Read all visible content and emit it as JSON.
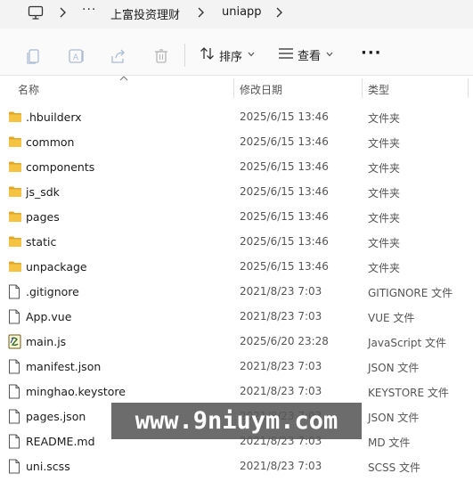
{
  "breadcrumb": {
    "more": "···",
    "items": [
      "上富投资理财",
      "uniapp"
    ]
  },
  "toolbar": {
    "sort_label": "排序",
    "view_label": "查看",
    "more_label": "···"
  },
  "columns": {
    "name": "名称",
    "date": "修改日期",
    "type": "类型"
  },
  "files": [
    {
      "name": ".hbuilderx",
      "date": "2025/6/15 13:46",
      "type": "文件夹",
      "kind": "folder"
    },
    {
      "name": "common",
      "date": "2025/6/15 13:46",
      "type": "文件夹",
      "kind": "folder"
    },
    {
      "name": "components",
      "date": "2025/6/15 13:46",
      "type": "文件夹",
      "kind": "folder"
    },
    {
      "name": "js_sdk",
      "date": "2025/6/15 13:46",
      "type": "文件夹",
      "kind": "folder"
    },
    {
      "name": "pages",
      "date": "2025/6/15 13:46",
      "type": "文件夹",
      "kind": "folder"
    },
    {
      "name": "static",
      "date": "2025/6/15 13:46",
      "type": "文件夹",
      "kind": "folder"
    },
    {
      "name": "unpackage",
      "date": "2025/6/15 13:46",
      "type": "文件夹",
      "kind": "folder"
    },
    {
      "name": ".gitignore",
      "date": "2021/8/23 7:03",
      "type": "GITIGNORE 文件",
      "kind": "file"
    },
    {
      "name": "App.vue",
      "date": "2021/8/23 7:03",
      "type": "VUE 文件",
      "kind": "file"
    },
    {
      "name": "main.js",
      "date": "2025/6/20 23:28",
      "type": "JavaScript 文件",
      "kind": "js"
    },
    {
      "name": "manifest.json",
      "date": "2021/8/23 7:03",
      "type": "JSON 文件",
      "kind": "file"
    },
    {
      "name": "minghao.keystore",
      "date": "2021/8/23 7:03",
      "type": "KEYSTORE 文件",
      "kind": "file"
    },
    {
      "name": "pages.json",
      "date": "2021/8/23 7:03",
      "type": "JSON 文件",
      "kind": "file"
    },
    {
      "name": "README.md",
      "date": "2021/8/23 7:03",
      "type": "MD 文件",
      "kind": "file"
    },
    {
      "name": "uni.scss",
      "date": "2021/8/23 7:03",
      "type": "SCSS 文件",
      "kind": "file"
    }
  ],
  "watermark": "www.9niuym.com",
  "colors": {
    "folder": "#f5c242",
    "folder_tab": "#e0a72a",
    "watermark_bg": "#585858"
  }
}
